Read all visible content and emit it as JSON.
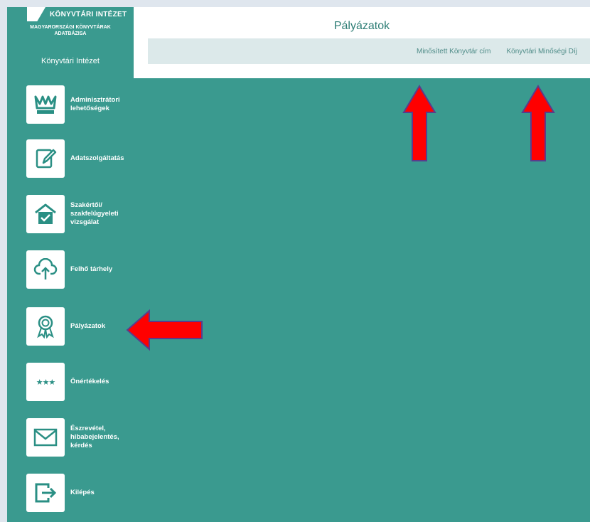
{
  "brand": {
    "name": "KÖNYVTÁRI INTÉZET",
    "subtitle_line1": "MAGYARORSZÁGI KÖNYVTÁRAK",
    "subtitle_line2": "ADATBÁZISA",
    "institute": "Könyvtári Intézet"
  },
  "header": {
    "title": "Pályázatok",
    "tabs": [
      {
        "label": "Minősített Könyvtár cím"
      },
      {
        "label": "Könyvtári Minőségi Díj"
      }
    ]
  },
  "sidebar": {
    "items": [
      {
        "label": "Adminisztrátori lehetőségek",
        "icon": "crown-icon"
      },
      {
        "label": "Adatszolgáltatás",
        "icon": "edit-document-icon"
      },
      {
        "label": "Szakértői/ szakfelügyeleti vizsgálat",
        "icon": "house-check-icon"
      },
      {
        "label": "Felhő tárhely",
        "icon": "cloud-upload-icon"
      },
      {
        "label": "Pályázatok",
        "icon": "award-ribbon-icon"
      },
      {
        "label": "Önértékelés",
        "icon": "stars-icon",
        "glyph": "★★★"
      },
      {
        "label": "Észrevétel, hibabejelentés, kérdés",
        "icon": "envelope-icon"
      },
      {
        "label": "Kilépés",
        "icon": "logout-icon"
      }
    ]
  },
  "colors": {
    "primary": "#3a9a8f",
    "icon": "#2a8f84",
    "annotation_arrow": "#ff0000",
    "annotation_arrow_border": "#5a3c8c"
  }
}
